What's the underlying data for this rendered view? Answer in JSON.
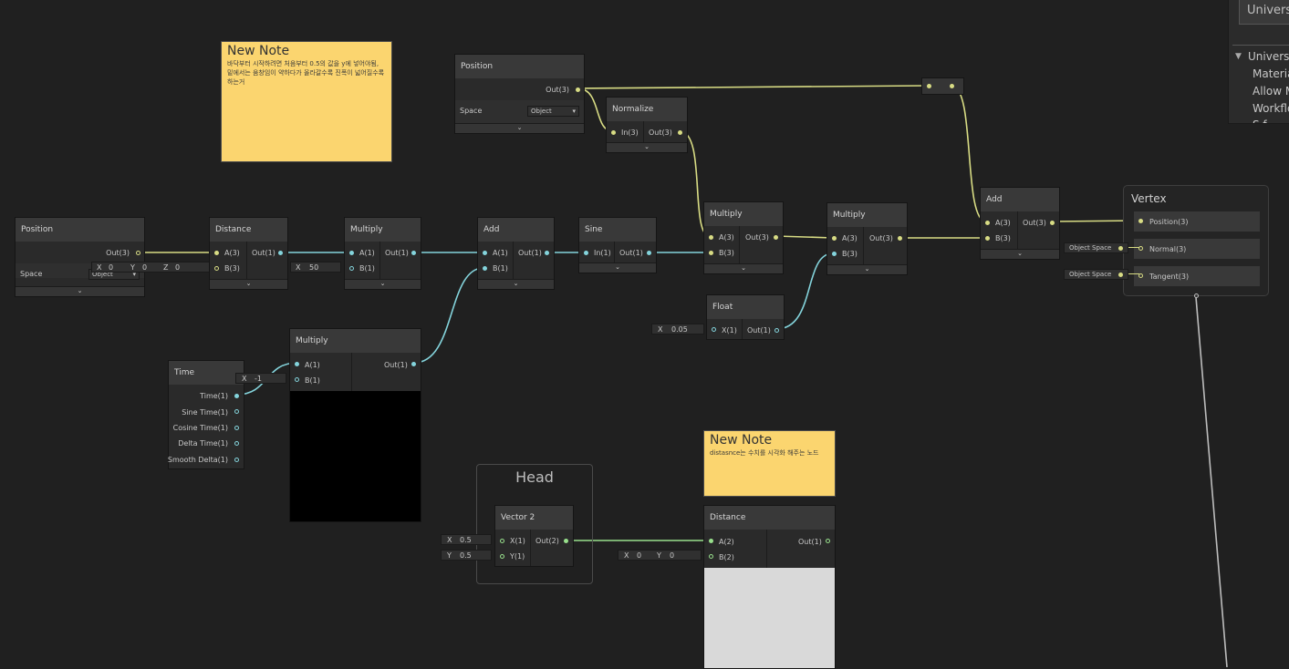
{
  "nodes": {
    "position_left": {
      "title": "Position",
      "out": "Out(3)",
      "space_label": "Space",
      "space_value": "Object"
    },
    "position_top": {
      "title": "Position",
      "out": "Out(3)",
      "space_label": "Space",
      "space_value": "Object"
    },
    "distance1": {
      "title": "Distance",
      "a": "A(3)",
      "b": "B(3)",
      "out": "Out(1)",
      "x": "X",
      "xv": "0",
      "y": "Y",
      "yv": "0",
      "z": "Z",
      "zv": "0"
    },
    "multiply1": {
      "title": "Multiply",
      "a": "A(1)",
      "b": "B(1)",
      "out": "Out(1)",
      "x": "X",
      "xv": "50"
    },
    "add1": {
      "title": "Add",
      "a": "A(1)",
      "b": "B(1)",
      "out": "Out(1)"
    },
    "sine": {
      "title": "Sine",
      "in": "In(1)",
      "out": "Out(1)"
    },
    "normalize": {
      "title": "Normalize",
      "in": "In(3)",
      "out": "Out(3)"
    },
    "multiply2": {
      "title": "Multiply",
      "a": "A(3)",
      "b": "B(3)",
      "out": "Out(3)"
    },
    "multiply3": {
      "title": "Multiply",
      "a": "A(3)",
      "b": "B(3)",
      "out": "Out(3)"
    },
    "float": {
      "title": "Float",
      "x": "X",
      "xv": "0.05",
      "in": "X(1)",
      "out": "Out(1)"
    },
    "add2": {
      "title": "Add",
      "a": "A(3)",
      "b": "B(3)",
      "out": "Out(3)"
    },
    "vertex": {
      "title": "Vertex",
      "position": "Position(3)",
      "normal": "Normal(3)",
      "tangent": "Tangent(3)",
      "normal_space": "Object Space",
      "tangent_space": "Object Space"
    },
    "multiply4": {
      "title": "Multiply",
      "a": "A(1)",
      "b": "B(1)",
      "out": "Out(1)",
      "x": "X",
      "xv": "-1"
    },
    "time": {
      "title": "Time",
      "outs": [
        "Time(1)",
        "Sine Time(1)",
        "Cosine Time(1)",
        "Delta Time(1)",
        "Smooth Delta(1)"
      ]
    },
    "vector2": {
      "title": "Vector 2",
      "x": "X(1)",
      "y": "Y(1)",
      "out": "Out(2)",
      "xl": "X",
      "xv": "0.5",
      "yl": "Y",
      "yv": "0.5"
    },
    "distance2": {
      "title": "Distance",
      "a": "A(2)",
      "b": "B(2)",
      "out": "Out(1)",
      "x": "X",
      "xv": "0",
      "y": "Y",
      "yv": "0"
    }
  },
  "group": {
    "title": "Head"
  },
  "notes": [
    {
      "title": "New Note",
      "body": "바닥부터 시작하려면 처음부터 0.5의 값을 y에 넣어야됨, 밑에서는 움창임이 약하다가 올라갈수록 진폭이 넓어질수록 하는거"
    },
    {
      "title": "New Note",
      "body": "distasnce는 수치를 시각화 해주는 노드"
    }
  ],
  "inspector": {
    "title": "Universa",
    "section": "Universa",
    "items": [
      "Materia",
      "Allow M",
      "Workflo",
      "S f"
    ]
  },
  "chevron": "⌄",
  "dropdown_arrow": "▾",
  "tri": "▼"
}
